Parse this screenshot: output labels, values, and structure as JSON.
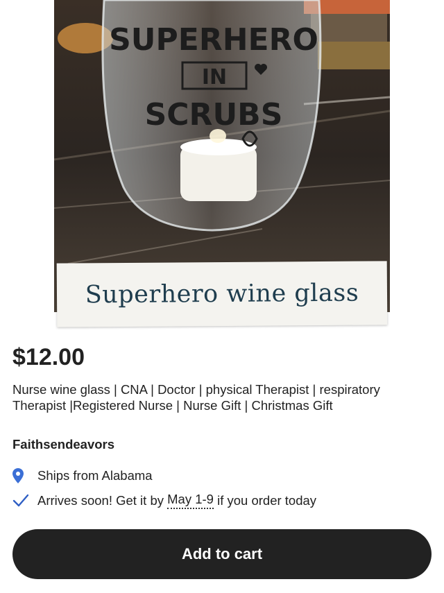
{
  "image": {
    "glass_print_line1": "SUPERHERO",
    "glass_print_line2": "IN",
    "glass_print_line3": "SCRUBS",
    "caption": "Superhero wine glass"
  },
  "listing": {
    "price": "$12.00",
    "title": "Nurse wine glass | CNA | Doctor | physical Therapist | respiratory Therapist |Registered Nurse | Nurse Gift | Christmas Gift",
    "shop_name": "Faithsendeavors"
  },
  "shipping": {
    "ships_from": "Ships from Alabama",
    "arrives_prefix": "Arrives soon! Get it by",
    "arrives_dates": "May 1-9",
    "arrives_suffix": "if you order today"
  },
  "actions": {
    "add_to_cart": "Add to cart"
  },
  "icons": {
    "location": "location-pin-icon",
    "check": "checkmark-icon"
  },
  "colors": {
    "button_bg": "#222222",
    "pin_blue": "#3b6fd6",
    "check_blue": "#2f5fc4",
    "caption_text": "#1f3d4e"
  }
}
